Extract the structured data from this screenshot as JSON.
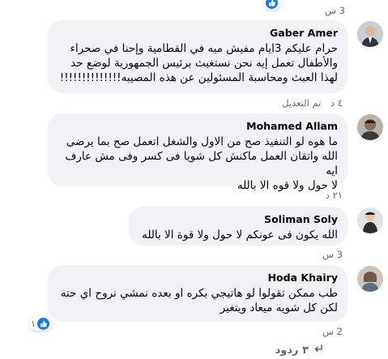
{
  "top": {
    "time": "3 س",
    "reaction_count": ""
  },
  "comments": [
    {
      "author": "Gaber Amer",
      "lines": [
        "حرام عليكم 3ايام مفيش ميه في القطامية وإحنا في صحراء",
        "والأطفال تعمل إيه نحن نستغيث برئيس الجمهورية لوضع حد",
        "لهذا العبث ومحاسبة المسئولين عن هذه المصيبه!!!!!!!!!!!!!!"
      ],
      "time": "٤ د",
      "edited": "تم التعديل"
    },
    {
      "author": "Mohamed Allam",
      "lines": [
        "ما هوه لو التنفيذ صح من الاول والشغل اتعمل صح بما يرضى",
        "الله واتقان العمل ماكنش كل شويا فى كسر وفى مش عارف ايه",
        "لا حول ولا قوه الا بالله"
      ],
      "time": "٢١ د"
    },
    {
      "author": "Soliman Soly",
      "lines": [
        "الله يكون فى عونكم لا حول ولا قوة الا بالله"
      ],
      "time": "3 س"
    },
    {
      "author": "Hoda Khairy",
      "lines": [
        "طب ممكن تقولوا لو هاتيجي بكره او بعده نمشي نروح اي حته",
        "لكن كل شويه ميعاد ويتغير"
      ],
      "time": "2 س",
      "reaction_count": "١"
    }
  ],
  "replies_link": "٣ ردود",
  "colors": {
    "bubble": "#f0f2f5",
    "meta": "#65676b",
    "like": "#1877f2"
  }
}
